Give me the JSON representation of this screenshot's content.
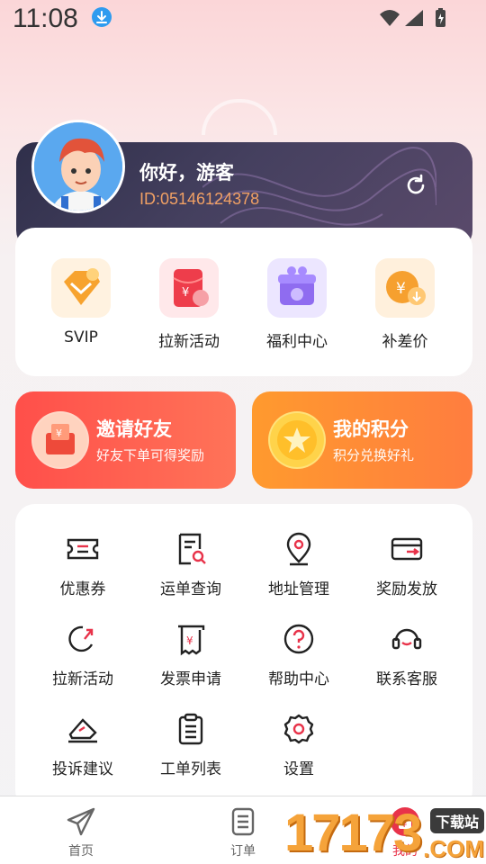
{
  "status_bar": {
    "time": "11:08"
  },
  "profile": {
    "greeting": "你好，游客",
    "user_id": "ID:05146124378"
  },
  "quick_actions": [
    {
      "label": "SVIP",
      "icon": "diamond-vip-icon"
    },
    {
      "label": "拉新活动",
      "icon": "red-envelope-icon"
    },
    {
      "label": "福利中心",
      "icon": "gift-box-icon"
    },
    {
      "label": "补差价",
      "icon": "yuan-coin-icon"
    }
  ],
  "promos": [
    {
      "title": "邀请好友",
      "subtitle": "好友下单可得奖励",
      "color": "#ff5e4d"
    },
    {
      "title": "我的积分",
      "subtitle": "积分兑换好礼",
      "color": "#ff8a3a"
    }
  ],
  "services": [
    {
      "label": "优惠券",
      "icon": "coupon-icon"
    },
    {
      "label": "运单查询",
      "icon": "waybill-search-icon"
    },
    {
      "label": "地址管理",
      "icon": "location-pin-icon"
    },
    {
      "label": "奖励发放",
      "icon": "card-reward-icon"
    },
    {
      "label": "拉新活动",
      "icon": "refresh-arrow-icon"
    },
    {
      "label": "发票申请",
      "icon": "invoice-icon"
    },
    {
      "label": "帮助中心",
      "icon": "help-question-icon"
    },
    {
      "label": "联系客服",
      "icon": "headset-icon"
    },
    {
      "label": "投诉建议",
      "icon": "complaint-tag-icon"
    },
    {
      "label": "工单列表",
      "icon": "clipboard-list-icon"
    },
    {
      "label": "设置",
      "icon": "gear-icon"
    }
  ],
  "tabs": [
    {
      "label": "首页",
      "icon": "paper-plane-icon"
    },
    {
      "label": "订单",
      "icon": "order-list-icon"
    },
    {
      "label": "我的",
      "icon": "mine-icon"
    }
  ],
  "watermark": {
    "number": "17173",
    "site": "下载站",
    "domain": ".COM"
  },
  "colors": {
    "accent": "#e8334a",
    "id_text": "#f0a064",
    "card_dark": "#2f2f4a"
  }
}
